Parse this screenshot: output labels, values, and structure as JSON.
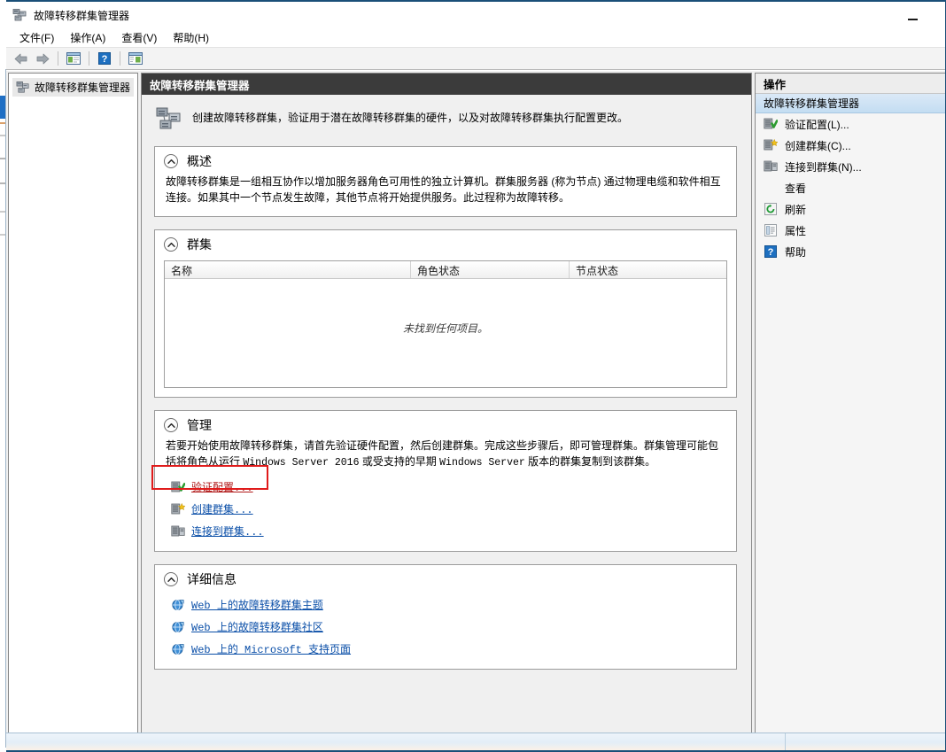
{
  "window": {
    "title": "故障转移群集管理器",
    "icon": "cluster-icon",
    "minimize_label": "最小化"
  },
  "menubar": {
    "items": [
      {
        "label": "文件(F)",
        "name": "menu-file"
      },
      {
        "label": "操作(A)",
        "name": "menu-action"
      },
      {
        "label": "查看(V)",
        "name": "menu-view"
      },
      {
        "label": "帮助(H)",
        "name": "menu-help"
      }
    ]
  },
  "toolbar": {
    "buttons": [
      {
        "name": "back-arrow-icon",
        "tip": "后退"
      },
      {
        "name": "forward-arrow-icon",
        "tip": "前进"
      },
      {
        "name": "show-hide-tree-icon",
        "tip": "显示/隐藏控制台树"
      },
      {
        "name": "help-icon",
        "tip": "帮助"
      },
      {
        "name": "show-hide-action-pane-icon",
        "tip": "显示/隐藏操作窗格"
      }
    ]
  },
  "tree": {
    "root": {
      "label": "故障转移群集管理器",
      "icon": "cluster-icon"
    }
  },
  "center": {
    "header": "故障转移群集管理器",
    "intro": "创建故障转移群集，验证用于潜在故障转移群集的硬件，以及对故障转移群集执行配置更改。",
    "sections": {
      "overview": {
        "title": "概述",
        "paragraph": "故障转移群集是一组相互协作以增加服务器角色可用性的独立计算机。群集服务器 (称为节点) 通过物理电缆和软件相互连接。如果其中一个节点发生故障，其他节点将开始提供服务。此过程称为故障转移。"
      },
      "clusters": {
        "title": "群集",
        "columns": [
          "名称",
          "角色状态",
          "节点状态"
        ],
        "empty_message": "未找到任何项目。",
        "rows": []
      },
      "management": {
        "title": "管理",
        "paragraph_part1": "若要开始使用故障转移群集，请首先验证硬件配置，然后创建群集。完成这些步骤后，即可管理群集。群集管理可能包括将角色从运行 ",
        "paragraph_mono1": "Windows Server 2016",
        "paragraph_part2": " 或受支持的早期 ",
        "paragraph_mono2": "Windows Server",
        "paragraph_part3": " 版本的群集复制到该群集。",
        "links": [
          {
            "label": "验证配置...",
            "name": "validate-configuration-link",
            "icon": "server-check-icon",
            "highlighted": true
          },
          {
            "label": "创建群集...",
            "name": "create-cluster-link",
            "icon": "server-new-icon",
            "highlighted": false
          },
          {
            "label": "连接到群集...",
            "name": "connect-to-cluster-link",
            "icon": "server-connect-icon",
            "highlighted": false
          }
        ]
      },
      "details": {
        "title": "详细信息",
        "links": [
          {
            "label": "Web 上的故障转移群集主题",
            "name": "web-failover-cluster-topics-link",
            "icon": "globe-icon"
          },
          {
            "label": "Web 上的故障转移群集社区",
            "name": "web-failover-cluster-community-link",
            "icon": "globe-icon"
          },
          {
            "label": "Web 上的 Microsoft 支持页面",
            "name": "web-microsoft-support-link",
            "icon": "globe-icon"
          }
        ]
      }
    }
  },
  "actions": {
    "header": "操作",
    "group_title": "故障转移群集管理器",
    "items": [
      {
        "label": "验证配置(L)...",
        "name": "action-validate-configuration",
        "icon": "server-check-icon"
      },
      {
        "label": "创建群集(C)...",
        "name": "action-create-cluster",
        "icon": "server-new-icon"
      },
      {
        "label": "连接到群集(N)...",
        "name": "action-connect-to-cluster",
        "icon": "server-connect-icon"
      },
      {
        "label": "查看",
        "name": "action-view",
        "icon": ""
      },
      {
        "label": "刷新",
        "name": "action-refresh",
        "icon": "refresh-icon"
      },
      {
        "label": "属性",
        "name": "action-properties",
        "icon": "properties-icon"
      },
      {
        "label": "帮助",
        "name": "action-help",
        "icon": "help-icon"
      }
    ]
  },
  "statusbar": {
    "text": "",
    "right_text": ""
  },
  "colors": {
    "header_bar": "#3b3b3b",
    "accent_link": "#0b4fa8",
    "highlight_box": "#e01b1b",
    "selection_blue": "#c3ddf2"
  }
}
